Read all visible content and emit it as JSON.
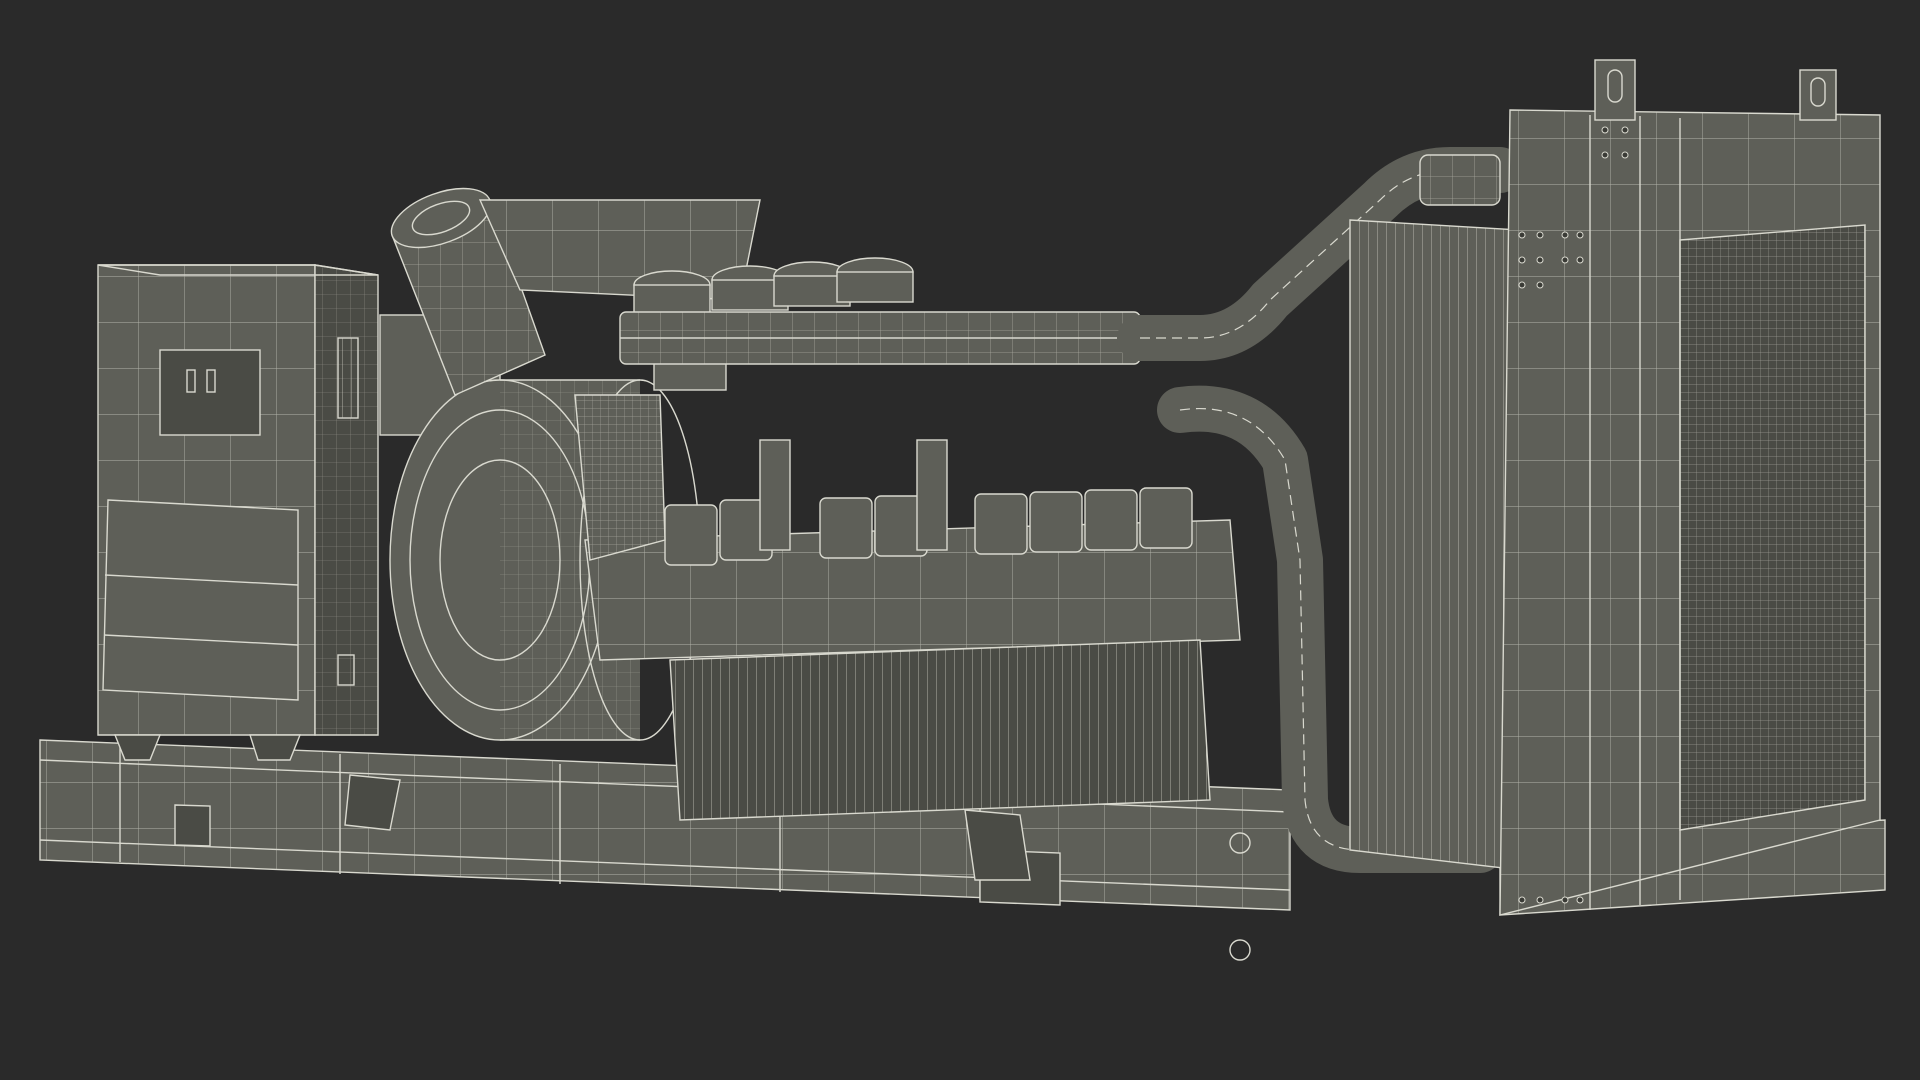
{
  "scene": {
    "subject": "wireframe-diesel-generator-set",
    "colors": {
      "background": "#2a2a2a",
      "body_fill": "#5e5f58",
      "body_dark": "#4a4b45",
      "body_shadow": "#3a3b36",
      "wire": "#d9d9cf",
      "wire_faint": "#a9aaa0"
    }
  }
}
